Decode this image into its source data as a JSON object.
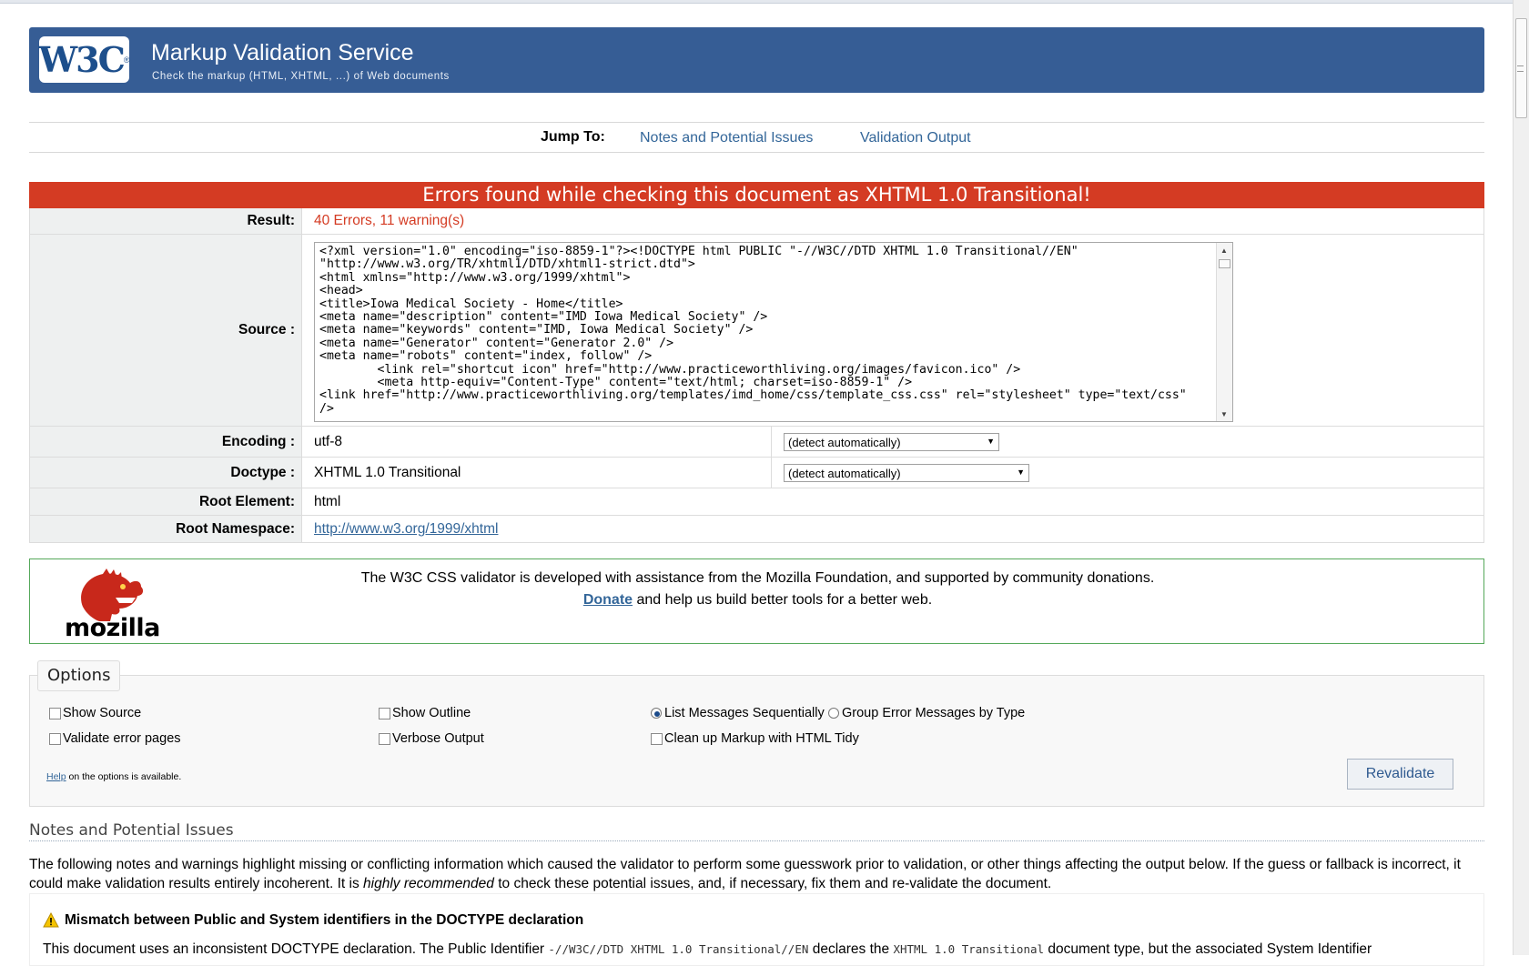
{
  "banner": {
    "logo_text": "W3C",
    "logo_reg": "®",
    "title": "Markup Validation Service",
    "subtitle": "Check the markup (HTML, XHTML, ...) of Web documents"
  },
  "jump": {
    "label": "Jump To:",
    "links": [
      "Notes and Potential Issues",
      "Validation Output"
    ]
  },
  "result": {
    "header": "Errors found while checking this document as XHTML 1.0 Transitional!",
    "result_label": "Result:",
    "result_value": "40 Errors, 11 warning(s)",
    "source_label": "Source :",
    "source_text": "<?xml version=\"1.0\" encoding=\"iso-8859-1\"?><!DOCTYPE html PUBLIC \"-//W3C//DTD XHTML 1.0 Transitional//EN\"\n\"http://www.w3.org/TR/xhtml1/DTD/xhtml1-strict.dtd\">\n<html xmlns=\"http://www.w3.org/1999/xhtml\">\n<head>\n<title>Iowa Medical Society - Home</title>\n<meta name=\"description\" content=\"IMD Iowa Medical Society\" />\n<meta name=\"keywords\" content=\"IMD, Iowa Medical Society\" />\n<meta name=\"Generator\" content=\"Generator 2.0\" />\n<meta name=\"robots\" content=\"index, follow\" />\n        <link rel=\"shortcut icon\" href=\"http://www.practiceworthliving.org/images/favicon.ico\" />\n        <meta http-equiv=\"Content-Type\" content=\"text/html; charset=iso-8859-1\" />\n<link href=\"http://www.practiceworthliving.org/templates/imd_home/css/template_css.css\" rel=\"stylesheet\" type=\"text/css\"\n/>",
    "encoding_label": "Encoding :",
    "encoding_value": "utf-8",
    "encoding_select": "(detect automatically)",
    "doctype_label": "Doctype :",
    "doctype_value": "XHTML 1.0 Transitional",
    "doctype_select": "(detect automatically)",
    "root_label": "Root Element:",
    "root_value": "html",
    "ns_label": "Root Namespace:",
    "ns_value": "http://www.w3.org/1999/xhtml"
  },
  "sponsor": {
    "logo_text": "mozilla",
    "line1": "The W3C CSS validator is developed with assistance from the Mozilla Foundation, and supported by community donations.",
    "donate_link": "Donate",
    "line2_rest": " and help us build better tools for a better web."
  },
  "options": {
    "legend": "Options",
    "show_source": "Show Source",
    "show_outline": "Show Outline",
    "list_sequential": "List Messages Sequentially",
    "group_by_type": "Group Error Messages by Type",
    "validate_error_pages": "Validate error pages",
    "verbose_output": "Verbose Output",
    "clean_up": "Clean up Markup with HTML Tidy",
    "help_link": "Help",
    "help_rest": " on the options is available.",
    "revalidate": "Revalidate",
    "selected_grouping": "List Messages Sequentially"
  },
  "notes": {
    "heading": "Notes and Potential Issues",
    "para_a": "The following notes and warnings highlight missing or conflicting information which caused the validator to perform some guesswork prior to validation, or other things affecting the output below. If the guess or fallback is incorrect, it could make validation results entirely incoherent. It is ",
    "para_em": "highly recommended",
    "para_b": " to check these potential issues, and, if necessary, fix them and re-validate the document.",
    "warning_title": "Mismatch between Public and System identifiers in the DOCTYPE declaration",
    "warning_desc_a": "This document uses an inconsistent DOCTYPE declaration. The Public Identifier ",
    "warning_code_a": "-//W3C//DTD XHTML 1.0 Transitional//EN",
    "warning_desc_b": " declares the ",
    "warning_code_b": "XHTML 1.0 Transitional",
    "warning_desc_c": " document type, but the associated System Identifier"
  },
  "colors": {
    "banner": "#365d95",
    "error": "#d43b23",
    "link": "#336699",
    "sponsor_border": "#55a85a"
  }
}
